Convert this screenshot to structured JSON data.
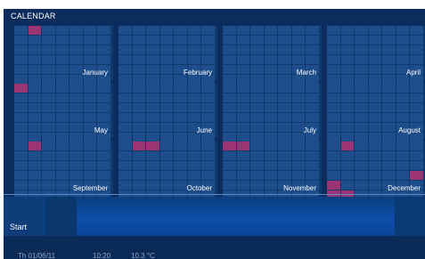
{
  "calendar": {
    "title": "CALENDAR",
    "months": [
      {
        "name": "January",
        "highlights": [
          1
        ]
      },
      {
        "name": "February",
        "highlights": []
      },
      {
        "name": "March",
        "highlights": []
      },
      {
        "name": "April",
        "highlights": []
      },
      {
        "name": "May",
        "highlights": [
          0
        ]
      },
      {
        "name": "June",
        "highlights": []
      },
      {
        "name": "July",
        "highlights": []
      },
      {
        "name": "August",
        "highlights": []
      },
      {
        "name": "September",
        "highlights": [
          1
        ]
      },
      {
        "name": "October",
        "highlights": [
          1,
          2
        ]
      },
      {
        "name": "November",
        "highlights": [
          0,
          1
        ]
      },
      {
        "name": "December",
        "highlights": [
          1,
          27,
          28,
          35,
          36
        ]
      }
    ]
  },
  "taskbar": {
    "start_label": "Start"
  },
  "status": {
    "date": "Th 01/06/11",
    "time": "10:20",
    "temperature": "10.3 °C"
  },
  "colors": {
    "background": "#0b2c5c",
    "day_cell": "#1e4d8c",
    "highlight": "#9c3372",
    "taskbar": "#0c4ea8"
  }
}
